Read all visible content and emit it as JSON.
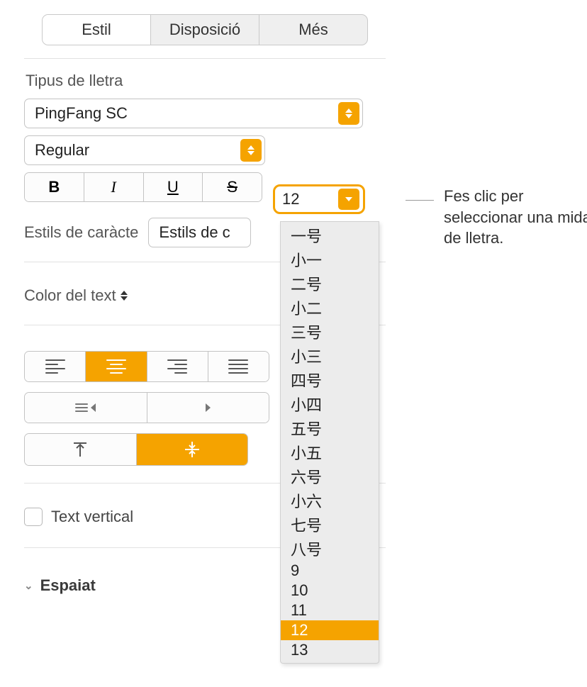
{
  "tabs": {
    "style": "Estil",
    "layout": "Disposició",
    "more": "Més"
  },
  "font": {
    "section_label": "Tipus de lletra",
    "family": "PingFang SC",
    "weight": "Regular",
    "size": "12"
  },
  "char_styles": {
    "label": "Estils de caràcte",
    "value": "Estils de c"
  },
  "text_color_label": "Color del text",
  "vertical_text_label": "Text vertical",
  "spacing_label": "Espaiat",
  "size_menu": {
    "items": [
      "一号",
      "小一",
      "二号",
      "小二",
      "三号",
      "小三",
      "四号",
      "小四",
      "五号",
      "小五",
      "六号",
      "小六",
      "七号",
      "八号",
      "9",
      "10",
      "11",
      "12",
      "13"
    ],
    "selected": "12"
  },
  "callout": "Fes clic per seleccionar una mida de lletra."
}
